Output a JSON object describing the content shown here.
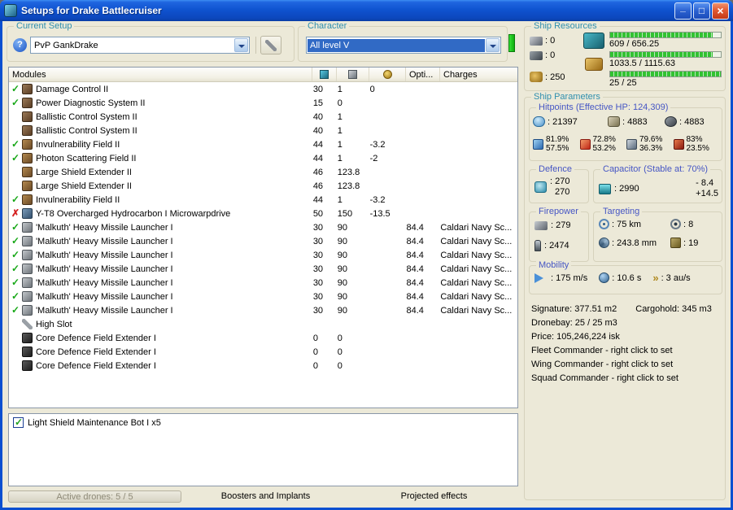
{
  "window": {
    "title": "Setups for Drake Battlecruiser"
  },
  "setup": {
    "group_label": "Current Setup",
    "value": "PvP GankDrake"
  },
  "character": {
    "group_label": "Character",
    "value": "All level V"
  },
  "ship_resources": {
    "group_label": "Ship Resources",
    "turret_hardpoints": ": 0",
    "launcher_hardpoints": ": 0",
    "calibration": ": 250",
    "cpu": "609 / 656.25",
    "powergrid": "1033.5 / 1115.63",
    "drone_bandwidth": "25 / 25"
  },
  "modules": {
    "header": {
      "name": "Modules",
      "opti": "Opti...",
      "charges": "Charges"
    },
    "rows": [
      {
        "status": "ok",
        "icon": "module",
        "name": "Damage Control II",
        "cpu": "30",
        "pg": "1",
        "cap": "0",
        "opti": "",
        "charges": ""
      },
      {
        "status": "ok",
        "icon": "module",
        "name": "Power Diagnostic System II",
        "cpu": "15",
        "pg": "0",
        "cap": "",
        "opti": "",
        "charges": ""
      },
      {
        "status": "",
        "icon": "module",
        "name": "Ballistic Control System II",
        "cpu": "40",
        "pg": "1",
        "cap": "",
        "opti": "",
        "charges": ""
      },
      {
        "status": "",
        "icon": "module",
        "name": "Ballistic Control System II",
        "cpu": "40",
        "pg": "1",
        "cap": "",
        "opti": "",
        "charges": ""
      },
      {
        "status": "ok",
        "icon": "shield",
        "name": "Invulnerability Field II",
        "cpu": "44",
        "pg": "1",
        "cap": "-3.2",
        "opti": "",
        "charges": ""
      },
      {
        "status": "ok",
        "icon": "shield",
        "name": "Photon Scattering Field II",
        "cpu": "44",
        "pg": "1",
        "cap": "-2",
        "opti": "",
        "charges": ""
      },
      {
        "status": "",
        "icon": "shield",
        "name": "Large Shield Extender II",
        "cpu": "46",
        "pg": "123.8",
        "cap": "",
        "opti": "",
        "charges": ""
      },
      {
        "status": "",
        "icon": "shield",
        "name": "Large Shield Extender II",
        "cpu": "46",
        "pg": "123.8",
        "cap": "",
        "opti": "",
        "charges": ""
      },
      {
        "status": "ok",
        "icon": "shield",
        "name": "Invulnerability Field II",
        "cpu": "44",
        "pg": "1",
        "cap": "-3.2",
        "opti": "",
        "charges": ""
      },
      {
        "status": "error",
        "icon": "prop",
        "name": "Y-T8 Overcharged Hydrocarbon I Microwarpdrive",
        "cpu": "50",
        "pg": "150",
        "cap": "-13.5",
        "opti": "",
        "charges": ""
      },
      {
        "status": "ok",
        "icon": "launcher",
        "name": "'Malkuth' Heavy Missile Launcher I",
        "cpu": "30",
        "pg": "90",
        "cap": "",
        "opti": "84.4",
        "charges": "Caldari Navy Sc..."
      },
      {
        "status": "ok",
        "icon": "launcher",
        "name": "'Malkuth' Heavy Missile Launcher I",
        "cpu": "30",
        "pg": "90",
        "cap": "",
        "opti": "84.4",
        "charges": "Caldari Navy Sc..."
      },
      {
        "status": "ok",
        "icon": "launcher",
        "name": "'Malkuth' Heavy Missile Launcher I",
        "cpu": "30",
        "pg": "90",
        "cap": "",
        "opti": "84.4",
        "charges": "Caldari Navy Sc..."
      },
      {
        "status": "ok",
        "icon": "launcher",
        "name": "'Malkuth' Heavy Missile Launcher I",
        "cpu": "30",
        "pg": "90",
        "cap": "",
        "opti": "84.4",
        "charges": "Caldari Navy Sc..."
      },
      {
        "status": "ok",
        "icon": "launcher",
        "name": "'Malkuth' Heavy Missile Launcher I",
        "cpu": "30",
        "pg": "90",
        "cap": "",
        "opti": "84.4",
        "charges": "Caldari Navy Sc..."
      },
      {
        "status": "ok",
        "icon": "launcher",
        "name": "'Malkuth' Heavy Missile Launcher I",
        "cpu": "30",
        "pg": "90",
        "cap": "",
        "opti": "84.4",
        "charges": "Caldari Navy Sc..."
      },
      {
        "status": "ok",
        "icon": "launcher",
        "name": "'Malkuth' Heavy Missile Launcher I",
        "cpu": "30",
        "pg": "90",
        "cap": "",
        "opti": "84.4",
        "charges": "Caldari Navy Sc..."
      },
      {
        "status": "",
        "icon": "tool",
        "name": "High Slot",
        "cpu": "",
        "pg": "",
        "cap": "",
        "opti": "",
        "charges": ""
      },
      {
        "status": "",
        "icon": "rig",
        "name": "Core Defence Field Extender I",
        "cpu": "0",
        "pg": "0",
        "cap": "",
        "opti": "",
        "charges": ""
      },
      {
        "status": "",
        "icon": "rig",
        "name": "Core Defence Field Extender I",
        "cpu": "0",
        "pg": "0",
        "cap": "",
        "opti": "",
        "charges": ""
      },
      {
        "status": "",
        "icon": "rig",
        "name": "Core Defence Field Extender I",
        "cpu": "0",
        "pg": "0",
        "cap": "",
        "opti": "",
        "charges": ""
      }
    ]
  },
  "drones": {
    "items": [
      {
        "checked": true,
        "label": "Light Shield Maintenance Bot I x5"
      }
    ]
  },
  "bottom_tabs": {
    "active_drones": "Active drones: 5 / 5",
    "boosters": "Boosters and Implants",
    "projected": "Projected effects"
  },
  "ship_parameters": {
    "group_label": "Ship Parameters",
    "hitpoints": {
      "title": "Hitpoints (Effective HP: 124,309)",
      "shield": ": 21397",
      "armor": ": 4883",
      "structure": ": 4883",
      "resists": [
        {
          "top": "81.9%",
          "bottom": "57.5%"
        },
        {
          "top": "72.8%",
          "bottom": "53.2%"
        },
        {
          "top": "79.6%",
          "bottom": "36.3%"
        },
        {
          "top": "83%",
          "bottom": "23.5%"
        }
      ]
    },
    "defence": {
      "title": "Defence",
      "top": ": 270",
      "bottom": "270"
    },
    "capacitor": {
      "title": "Capacitor (Stable at: 70%)",
      "amount": ": 2990",
      "peak": "- 8.4",
      "recharge": "+14.5"
    },
    "firepower": {
      "title": "Firepower",
      "volley": ": 279",
      "dps": ": 2474"
    },
    "targeting": {
      "title": "Targeting",
      "range": ": 75 km",
      "max_targets": ": 8",
      "scan_resolution": ": 243.8 mm",
      "sensor_strength": ": 19"
    },
    "mobility": {
      "title": "Mobility",
      "speed": ": 175 m/s",
      "align_time": ": 10.6 s",
      "warp_speed": ": 3 au/s"
    },
    "info": {
      "signature": "Signature: 377.51 m2",
      "cargohold": "Cargohold: 345 m3",
      "dronebay": "Dronebay: 25 / 25 m3",
      "price": "Price: 105,246,224 isk",
      "fleet": "Fleet Commander - right click to set",
      "wing": "Wing Commander - right click to set",
      "squad": "Squad Commander - right click to set"
    }
  }
}
